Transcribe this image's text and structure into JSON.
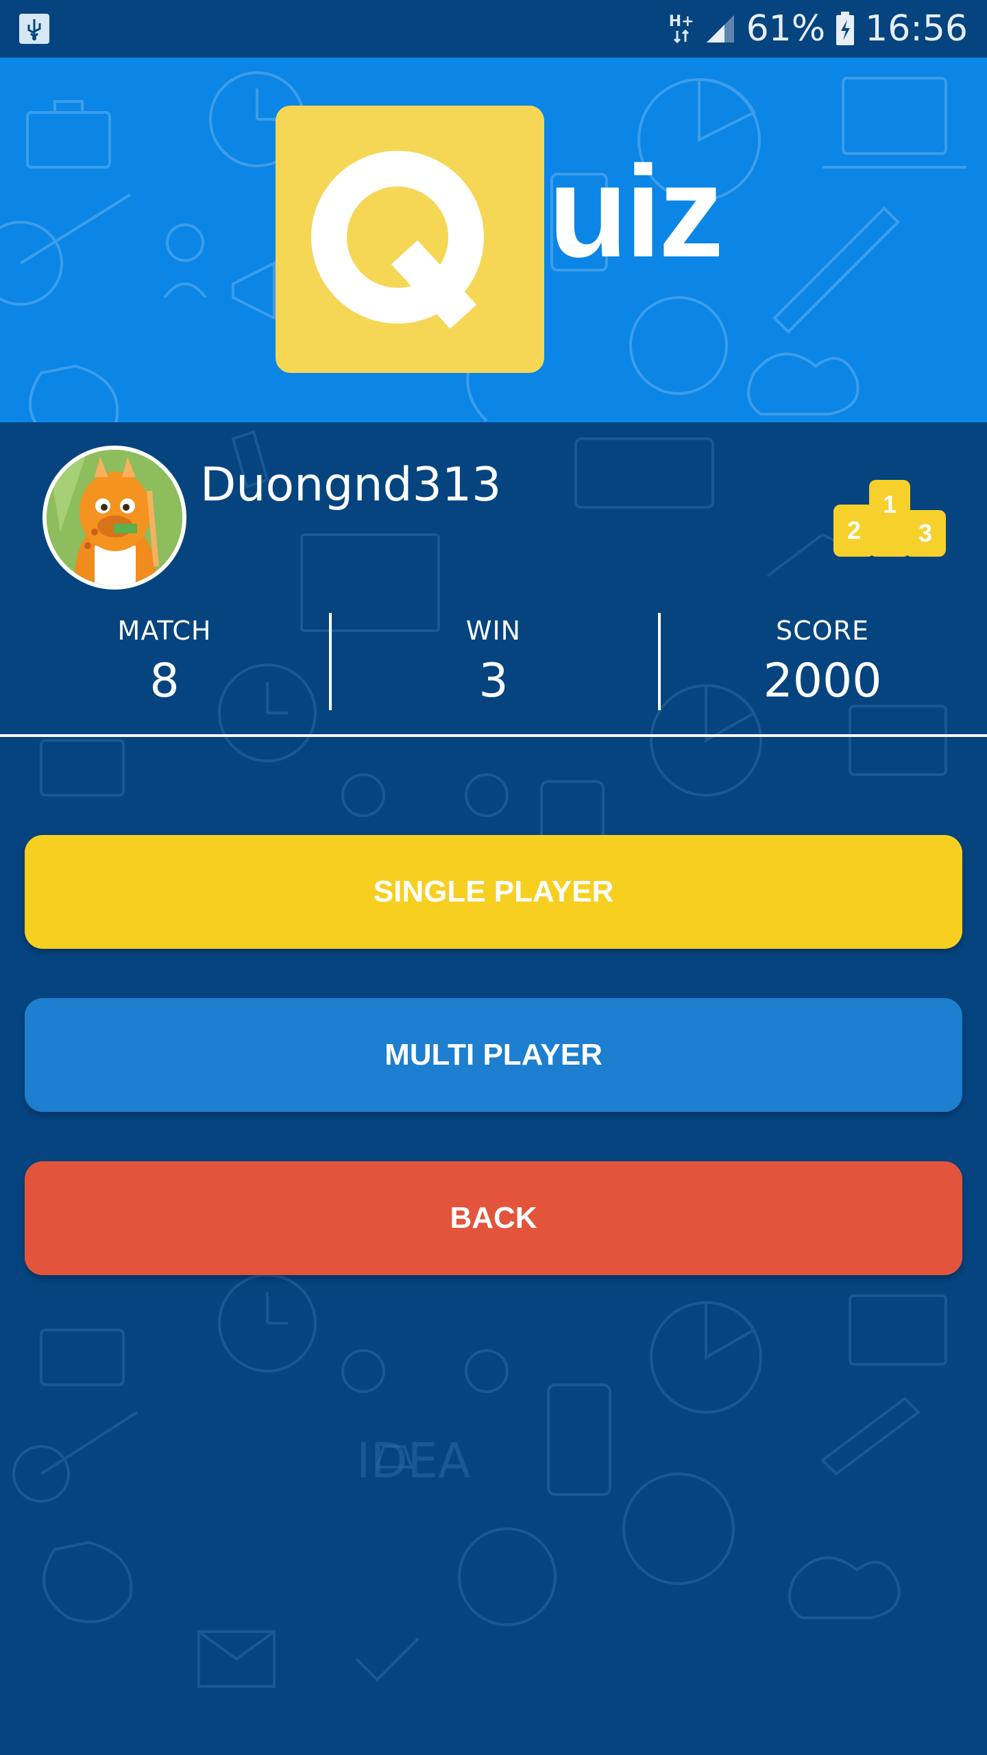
{
  "status_bar": {
    "network_type": "H+",
    "battery_percent": "61%",
    "time": "16:56",
    "icons": [
      "usb-icon",
      "data-arrows-icon",
      "signal-icon",
      "battery-charging-icon"
    ]
  },
  "logo": {
    "badge_letter": "Q",
    "rest_text": "uiz",
    "badge_color": "#f6d655"
  },
  "profile": {
    "username": "Duongnd313",
    "leaderboard_icon": "podium-icon",
    "podium_numbers": [
      "1",
      "2",
      "3"
    ]
  },
  "stats": [
    {
      "label": "MATCH",
      "value": "8"
    },
    {
      "label": "WIN",
      "value": "3"
    },
    {
      "label": "SCORE",
      "value": "2000"
    }
  ],
  "buttons": {
    "single_player": "SINGLE PLAYER",
    "multi_player": "MULTI PLAYER",
    "back": "BACK"
  },
  "colors": {
    "header_blue": "#0b86e6",
    "background_navy": "#05447f",
    "single_player": "#f6cf21",
    "multi_player": "#1e7ecf",
    "back": "#e2553c"
  }
}
